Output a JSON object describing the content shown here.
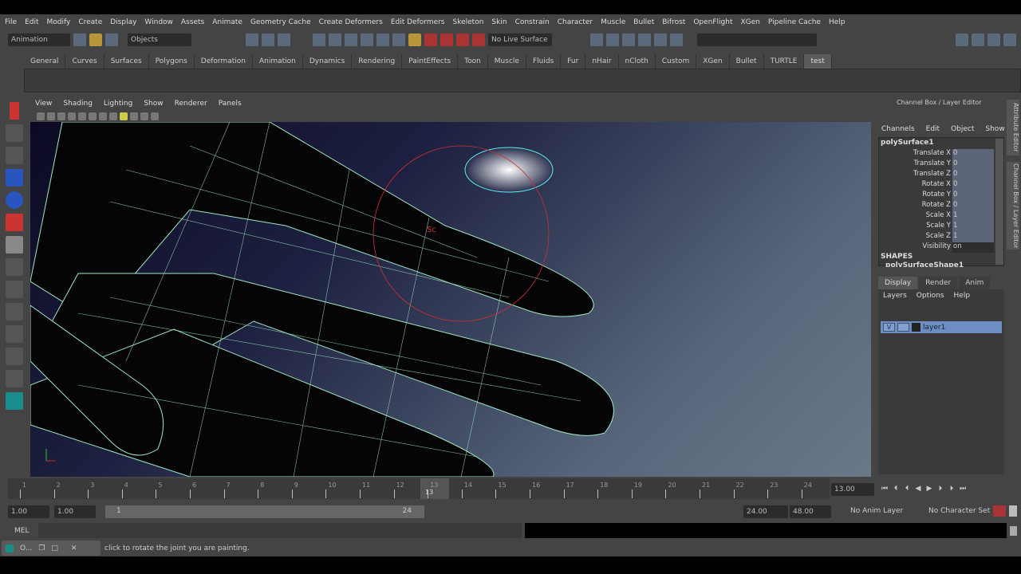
{
  "menubar": [
    "File",
    "Edit",
    "Modify",
    "Create",
    "Display",
    "Window",
    "Assets",
    "Animate",
    "Geometry Cache",
    "Create Deformers",
    "Edit Deformers",
    "Skeleton",
    "Skin",
    "Constrain",
    "Character",
    "Muscle",
    "Bullet",
    "Bifrost",
    "OpenFlight",
    "XGen",
    "Pipeline Cache",
    "Help"
  ],
  "status": {
    "menuset": "Animation",
    "selection_mode": "Objects",
    "live_surface": "No Live Surface",
    "input_field": ""
  },
  "shelf_tabs": [
    "General",
    "Curves",
    "Surfaces",
    "Polygons",
    "Deformation",
    "Animation",
    "Dynamics",
    "Rendering",
    "PaintEffects",
    "Toon",
    "Muscle",
    "Fluids",
    "Fur",
    "nHair",
    "nCloth",
    "Custom",
    "XGen",
    "Bullet",
    "TURTLE",
    "test"
  ],
  "shelf_active": "test",
  "viewport": {
    "menu": [
      "View",
      "Shading",
      "Lighting",
      "Show",
      "Renderer",
      "Panels"
    ],
    "manip_label": "Sc"
  },
  "channel_box": {
    "title": "Channel Box / Layer Editor",
    "menu": [
      "Channels",
      "Edit",
      "Object",
      "Show"
    ],
    "object": "polySurface1",
    "channels": [
      {
        "label": "Translate X",
        "value": "0"
      },
      {
        "label": "Translate Y",
        "value": "0"
      },
      {
        "label": "Translate Z",
        "value": "0"
      },
      {
        "label": "Rotate X",
        "value": "0"
      },
      {
        "label": "Rotate Y",
        "value": "0"
      },
      {
        "label": "Rotate Z",
        "value": "0"
      },
      {
        "label": "Scale X",
        "value": "1"
      },
      {
        "label": "Scale Y",
        "value": "1"
      },
      {
        "label": "Scale Z",
        "value": "1"
      },
      {
        "label": "Visibility",
        "value": "on"
      }
    ],
    "shapes_header": "SHAPES",
    "shape": "polySurfaceShape1"
  },
  "side_tabs": [
    "Attribute Editor",
    "Channel Box / Layer Editor"
  ],
  "layer_editor": {
    "tabs": [
      "Display",
      "Render",
      "Anim"
    ],
    "menu": [
      "Layers",
      "Options",
      "Help"
    ],
    "layer": {
      "visible": "V",
      "name": "layer1"
    }
  },
  "timeline": {
    "ticks": [
      "1",
      "2",
      "3",
      "4",
      "5",
      "6",
      "7",
      "8",
      "9",
      "10",
      "11",
      "12",
      "13",
      "14",
      "15",
      "16",
      "17",
      "18",
      "19",
      "20",
      "21",
      "22",
      "23",
      "24"
    ],
    "current": "13",
    "current_field": "13.00"
  },
  "range": {
    "start": "1.00",
    "anim_start": "1.00",
    "slider_start": "1",
    "slider_end": "24",
    "end": "24.00",
    "anim_end": "48.00",
    "anim_layer": "No Anim Layer",
    "character_set": "No Character Set"
  },
  "mel": {
    "label": "MEL"
  },
  "help": {
    "window": "O...",
    "text": "click to rotate the joint you are painting."
  },
  "colors": {
    "wire": "#9fe8c0",
    "selected_wire": "#5ff0f0",
    "manip": "#d03030",
    "layer": "#6c8ec2"
  }
}
